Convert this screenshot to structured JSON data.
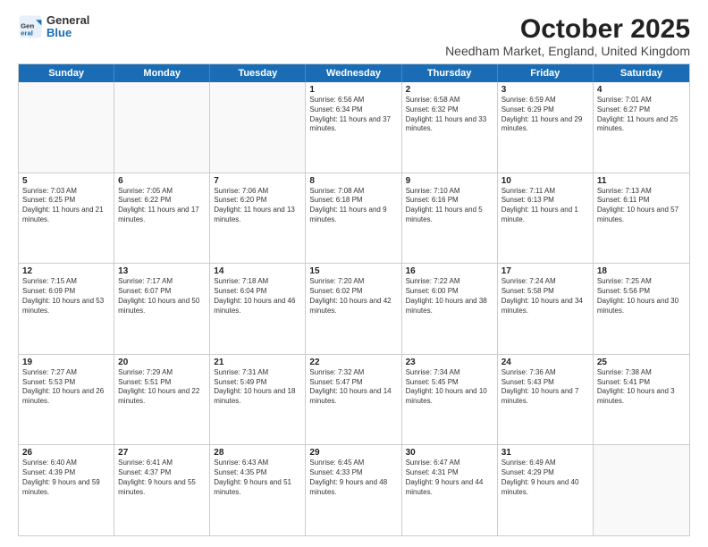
{
  "logo": {
    "general": "General",
    "blue": "Blue"
  },
  "title": "October 2025",
  "subtitle": "Needham Market, England, United Kingdom",
  "days": [
    "Sunday",
    "Monday",
    "Tuesday",
    "Wednesday",
    "Thursday",
    "Friday",
    "Saturday"
  ],
  "weeks": [
    [
      {
        "day": "",
        "content": ""
      },
      {
        "day": "",
        "content": ""
      },
      {
        "day": "",
        "content": ""
      },
      {
        "day": "1",
        "content": "Sunrise: 6:56 AM\nSunset: 6:34 PM\nDaylight: 11 hours and 37 minutes."
      },
      {
        "day": "2",
        "content": "Sunrise: 6:58 AM\nSunset: 6:32 PM\nDaylight: 11 hours and 33 minutes."
      },
      {
        "day": "3",
        "content": "Sunrise: 6:59 AM\nSunset: 6:29 PM\nDaylight: 11 hours and 29 minutes."
      },
      {
        "day": "4",
        "content": "Sunrise: 7:01 AM\nSunset: 6:27 PM\nDaylight: 11 hours and 25 minutes."
      }
    ],
    [
      {
        "day": "5",
        "content": "Sunrise: 7:03 AM\nSunset: 6:25 PM\nDaylight: 11 hours and 21 minutes."
      },
      {
        "day": "6",
        "content": "Sunrise: 7:05 AM\nSunset: 6:22 PM\nDaylight: 11 hours and 17 minutes."
      },
      {
        "day": "7",
        "content": "Sunrise: 7:06 AM\nSunset: 6:20 PM\nDaylight: 11 hours and 13 minutes."
      },
      {
        "day": "8",
        "content": "Sunrise: 7:08 AM\nSunset: 6:18 PM\nDaylight: 11 hours and 9 minutes."
      },
      {
        "day": "9",
        "content": "Sunrise: 7:10 AM\nSunset: 6:16 PM\nDaylight: 11 hours and 5 minutes."
      },
      {
        "day": "10",
        "content": "Sunrise: 7:11 AM\nSunset: 6:13 PM\nDaylight: 11 hours and 1 minute."
      },
      {
        "day": "11",
        "content": "Sunrise: 7:13 AM\nSunset: 6:11 PM\nDaylight: 10 hours and 57 minutes."
      }
    ],
    [
      {
        "day": "12",
        "content": "Sunrise: 7:15 AM\nSunset: 6:09 PM\nDaylight: 10 hours and 53 minutes."
      },
      {
        "day": "13",
        "content": "Sunrise: 7:17 AM\nSunset: 6:07 PM\nDaylight: 10 hours and 50 minutes."
      },
      {
        "day": "14",
        "content": "Sunrise: 7:18 AM\nSunset: 6:04 PM\nDaylight: 10 hours and 46 minutes."
      },
      {
        "day": "15",
        "content": "Sunrise: 7:20 AM\nSunset: 6:02 PM\nDaylight: 10 hours and 42 minutes."
      },
      {
        "day": "16",
        "content": "Sunrise: 7:22 AM\nSunset: 6:00 PM\nDaylight: 10 hours and 38 minutes."
      },
      {
        "day": "17",
        "content": "Sunrise: 7:24 AM\nSunset: 5:58 PM\nDaylight: 10 hours and 34 minutes."
      },
      {
        "day": "18",
        "content": "Sunrise: 7:25 AM\nSunset: 5:56 PM\nDaylight: 10 hours and 30 minutes."
      }
    ],
    [
      {
        "day": "19",
        "content": "Sunrise: 7:27 AM\nSunset: 5:53 PM\nDaylight: 10 hours and 26 minutes."
      },
      {
        "day": "20",
        "content": "Sunrise: 7:29 AM\nSunset: 5:51 PM\nDaylight: 10 hours and 22 minutes."
      },
      {
        "day": "21",
        "content": "Sunrise: 7:31 AM\nSunset: 5:49 PM\nDaylight: 10 hours and 18 minutes."
      },
      {
        "day": "22",
        "content": "Sunrise: 7:32 AM\nSunset: 5:47 PM\nDaylight: 10 hours and 14 minutes."
      },
      {
        "day": "23",
        "content": "Sunrise: 7:34 AM\nSunset: 5:45 PM\nDaylight: 10 hours and 10 minutes."
      },
      {
        "day": "24",
        "content": "Sunrise: 7:36 AM\nSunset: 5:43 PM\nDaylight: 10 hours and 7 minutes."
      },
      {
        "day": "25",
        "content": "Sunrise: 7:38 AM\nSunset: 5:41 PM\nDaylight: 10 hours and 3 minutes."
      }
    ],
    [
      {
        "day": "26",
        "content": "Sunrise: 6:40 AM\nSunset: 4:39 PM\nDaylight: 9 hours and 59 minutes."
      },
      {
        "day": "27",
        "content": "Sunrise: 6:41 AM\nSunset: 4:37 PM\nDaylight: 9 hours and 55 minutes."
      },
      {
        "day": "28",
        "content": "Sunrise: 6:43 AM\nSunset: 4:35 PM\nDaylight: 9 hours and 51 minutes."
      },
      {
        "day": "29",
        "content": "Sunrise: 6:45 AM\nSunset: 4:33 PM\nDaylight: 9 hours and 48 minutes."
      },
      {
        "day": "30",
        "content": "Sunrise: 6:47 AM\nSunset: 4:31 PM\nDaylight: 9 hours and 44 minutes."
      },
      {
        "day": "31",
        "content": "Sunrise: 6:49 AM\nSunset: 4:29 PM\nDaylight: 9 hours and 40 minutes."
      },
      {
        "day": "",
        "content": ""
      }
    ]
  ]
}
